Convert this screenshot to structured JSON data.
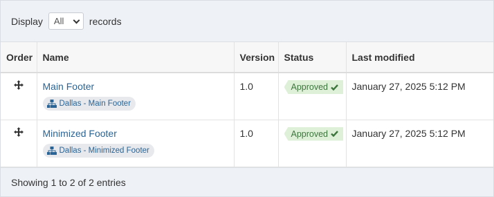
{
  "length_menu": {
    "prefix": "Display",
    "selected": "All",
    "suffix": "records"
  },
  "columns": [
    "Order",
    "Name",
    "Version",
    "Status",
    "Last modified"
  ],
  "rows": [
    {
      "name": "Main Footer",
      "tag": "Dallas - Main Footer",
      "version": "1.0",
      "status": "Approved",
      "modified": "January 27, 2025 5:12 PM"
    },
    {
      "name": "Minimized Footer",
      "tag": "Dallas - Minimized Footer",
      "version": "1.0",
      "status": "Approved",
      "modified": "January 27, 2025 5:12 PM"
    }
  ],
  "info": "Showing 1 to 2 of 2 entries",
  "icons": {
    "order": "move-arrows-icon",
    "tag": "sitemap-icon",
    "status": "check-icon"
  },
  "colors": {
    "link": "#2a6496",
    "approved_bg": "#dff0d8",
    "approved_text": "#3c763d"
  }
}
